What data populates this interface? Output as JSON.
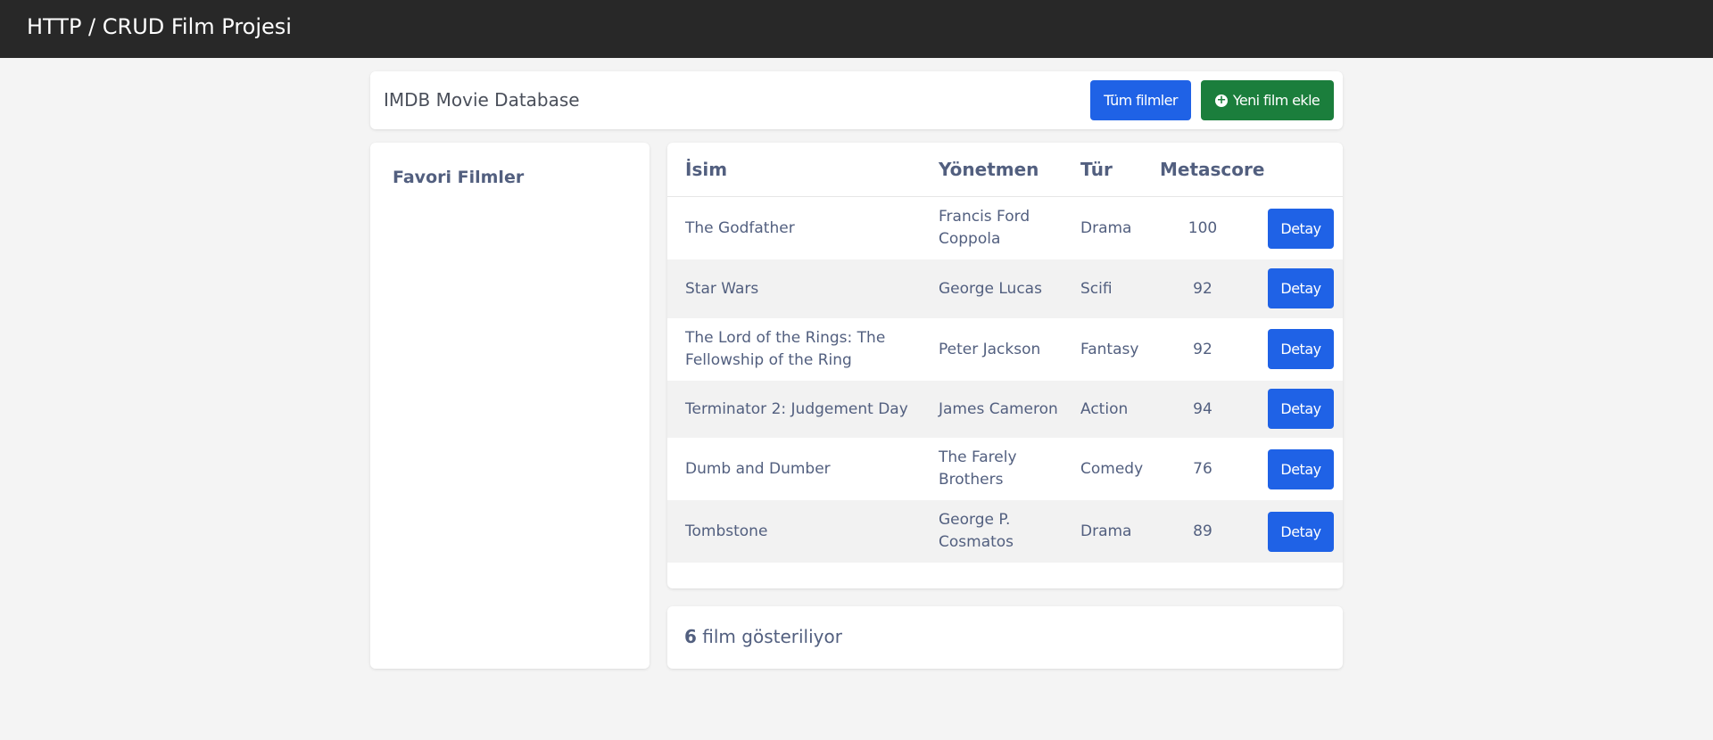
{
  "app": {
    "title": "HTTP / CRUD Film Projesi"
  },
  "header": {
    "title": "IMDB Movie Database",
    "all_films_label": "Tüm filmler",
    "add_film_label": "Yeni film ekle",
    "add_icon": "plus-circle-icon"
  },
  "sidebar": {
    "title": "Favori Filmler"
  },
  "table": {
    "headers": {
      "name": "İsim",
      "director": "Yönetmen",
      "genre": "Tür",
      "metascore": "Metascore"
    },
    "detail_label": "Detay",
    "rows": [
      {
        "name": "The Godfather",
        "director": "Francis Ford Coppola",
        "genre": "Drama",
        "metascore": "100"
      },
      {
        "name": "Star Wars",
        "director": "George Lucas",
        "genre": "Scifi",
        "metascore": "92"
      },
      {
        "name": "The Lord of the Rings: The Fellowship of the Ring",
        "director": "Peter Jackson",
        "genre": "Fantasy",
        "metascore": "92"
      },
      {
        "name": "Terminator 2: Judgement Day",
        "director": "James Cameron",
        "genre": "Action",
        "metascore": "94"
      },
      {
        "name": "Dumb and Dumber",
        "director": "The Farely Brothers",
        "genre": "Comedy",
        "metascore": "76"
      },
      {
        "name": "Tombstone",
        "director": "George P. Cosmatos",
        "genre": "Drama",
        "metascore": "89"
      }
    ]
  },
  "footer": {
    "count": "6",
    "count_suffix": " film gösteriliyor"
  },
  "colors": {
    "primary": "#1f62e6",
    "success": "#1b7e3c",
    "navbar": "#282828",
    "background": "#f4f4f4"
  }
}
